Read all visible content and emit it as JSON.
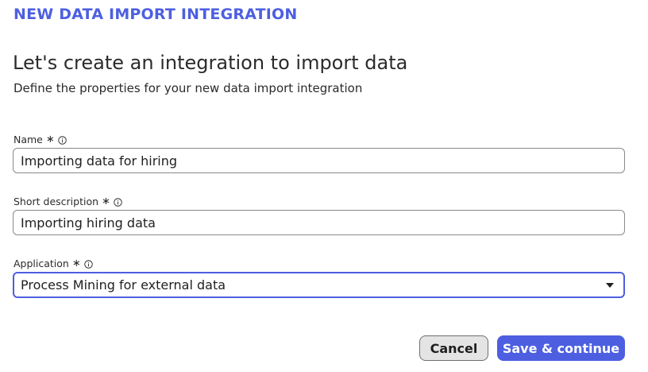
{
  "header": {
    "title": "NEW DATA IMPORT INTEGRATION"
  },
  "intro": {
    "heading": "Let's create an integration to import data",
    "subheading": "Define the properties for your new data import integration"
  },
  "form": {
    "name": {
      "label": "Name",
      "required_mark": "∗",
      "value": "Importing data for hiring"
    },
    "short_description": {
      "label": "Short description",
      "required_mark": "∗",
      "value": "Importing hiring data"
    },
    "application": {
      "label": "Application",
      "required_mark": "∗",
      "selected": "Process Mining for external data"
    }
  },
  "actions": {
    "cancel_label": "Cancel",
    "save_label": "Save & continue"
  },
  "colors": {
    "accent": "#4d5fe0",
    "cancel_bg": "#e4e4e4",
    "text": "#1f1f1f"
  },
  "icons": {
    "info": "info-circle-icon",
    "dropdown": "caret-down-icon"
  }
}
